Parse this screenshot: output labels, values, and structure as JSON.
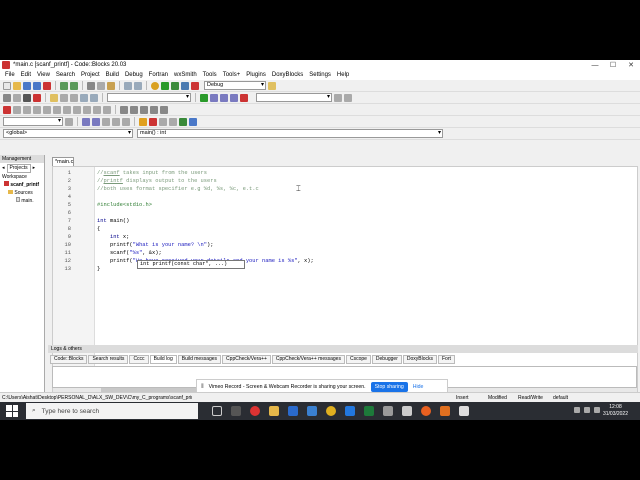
{
  "window": {
    "title": "*main.c [scanf_printf] - Code::Blocks 20.03",
    "controls": [
      "—",
      "☐",
      "✕"
    ]
  },
  "menu": [
    "File",
    "Edit",
    "View",
    "Search",
    "Project",
    "Build",
    "Debug",
    "Fortran",
    "wxSmith",
    "Tools",
    "Tools+",
    "Plugins",
    "DoxyBlocks",
    "Settings",
    "Help"
  ],
  "toolbar": {
    "build_target": "Debug",
    "scope_combo": "<global>",
    "symbol_combo": "main() : int"
  },
  "management": {
    "header": "Management",
    "tab": "Projects",
    "tree": [
      "Workspace",
      "scanf_printf",
      "Sources",
      "main."
    ]
  },
  "editor": {
    "tab_label": "*main.c",
    "lines": [
      {
        "n": "1",
        "html": "<span class='cmt'>//<u>scanf</u> takes input from the users</span>"
      },
      {
        "n": "2",
        "html": "<span class='cmt'>//<u>printf</u> displays output to the users</span>"
      },
      {
        "n": "3",
        "html": "<span class='cmt'>//both uses format specifier e.g %d, %s, %c, e.t.c</span>"
      },
      {
        "n": "4",
        "html": ""
      },
      {
        "n": "5",
        "html": "<span class='pre'>#include&lt;stdio.h&gt;</span>"
      },
      {
        "n": "6",
        "html": ""
      },
      {
        "n": "7",
        "html": "<span class='kw'>int</span> main()"
      },
      {
        "n": "8",
        "html": "{"
      },
      {
        "n": "9",
        "html": "    <span class='kw'>int</span> x;"
      },
      {
        "n": "10",
        "html": "    printf(<span class='str'>\"What is your name? \\n\"</span>);"
      },
      {
        "n": "11",
        "html": "    scanf(<span class='str'>\"%s\"</span>, &amp;x);"
      },
      {
        "n": "12",
        "html": "    printf(<span class='str'>\"He have received your details and your name is %s\"</span>, x);"
      },
      {
        "n": "13",
        "html": "}"
      }
    ],
    "calltip": "int printf(const char*, ...)"
  },
  "logs": {
    "header": "Logs & others",
    "tabs": [
      "Code::Blocks",
      "Search results",
      "Cccc",
      "Build log",
      "Build messages",
      "CppCheck/Vera++",
      "CppCheck/Vera++ messages",
      "Cscope",
      "Debugger",
      "DoxyBlocks",
      "Fort"
    ],
    "active_tab": 3
  },
  "vimeo": {
    "message": "Vimeo Record - Screen & Webcam Recorder is sharing your screen.",
    "stop_label": "Stop sharing",
    "hide_label": "Hide"
  },
  "status": {
    "path": "C:\\Users\\Aishat\\Desktop\\PERSONAL_D\\ALX_SW_DEV\\C\\my_C_programs\\scanf_printf\\main.c",
    "mode": "Insert",
    "modified": "Modified",
    "access": "Read/Write",
    "profile": "default"
  },
  "taskbar": {
    "search_placeholder": "Type here to search",
    "time": "12:08",
    "date": "31/03/2022"
  }
}
